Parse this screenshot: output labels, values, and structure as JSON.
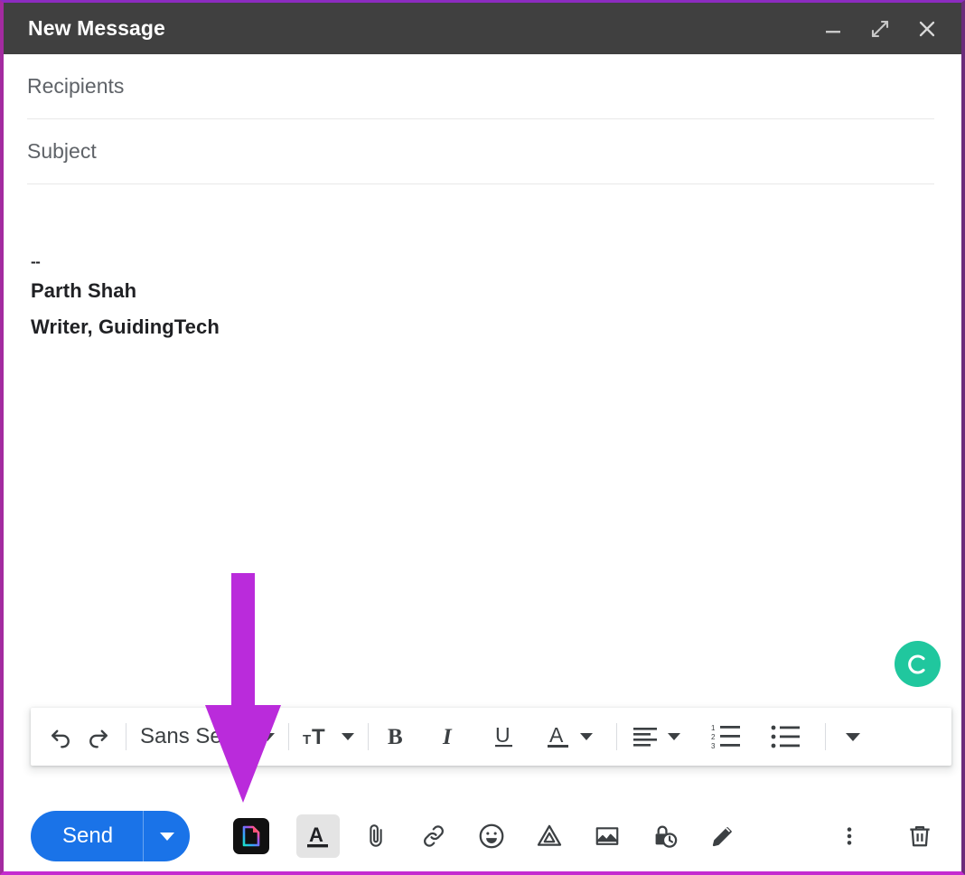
{
  "window": {
    "title": "New Message",
    "border_color": "#a32ba0",
    "titlebar_bg": "#404040",
    "controls": [
      {
        "name": "minimize",
        "label": "Minimize"
      },
      {
        "name": "expand",
        "label": "Full screen"
      },
      {
        "name": "close",
        "label": "Save & close"
      }
    ]
  },
  "fields": {
    "recipients_placeholder": "Recipients",
    "subject_placeholder": "Subject",
    "recipients_value": "",
    "subject_value": ""
  },
  "body": {
    "signature_separator": "--",
    "signature_name": "Parth Shah",
    "signature_title": "Writer, GuidingTech"
  },
  "assistant_badge": {
    "name": "grammarly-assistant",
    "color": "#20c79e"
  },
  "format_toolbar": {
    "undo_label": "Undo",
    "redo_label": "Redo",
    "font_family": "Sans Serif",
    "font_size_label": "Size",
    "bold_label": "B",
    "italic_label": "I",
    "underline_label": "U",
    "text_color_label": "A",
    "align_label": "Align",
    "numbered_list_label": "Numbered list",
    "bulleted_list_label": "Bulleted list",
    "more_format_label": "More formatting options"
  },
  "action_bar": {
    "send_label": "Send",
    "send_color": "#1a73e8",
    "send_options_label": "More send options",
    "extension_icon_label": "Document extension",
    "formatting_options_label": "Formatting options",
    "attach_label": "Attach files",
    "link_label": "Insert link",
    "emoji_label": "Insert emoji",
    "drive_label": "Insert files using Drive",
    "photo_label": "Insert photo",
    "confidential_label": "Toggle confidential mode",
    "signature_label": "Insert signature",
    "more_options_label": "More options",
    "discard_label": "Discard draft"
  },
  "annotation": {
    "arrow_color": "#ba2bdb",
    "points_to": "extension-icon-button"
  }
}
